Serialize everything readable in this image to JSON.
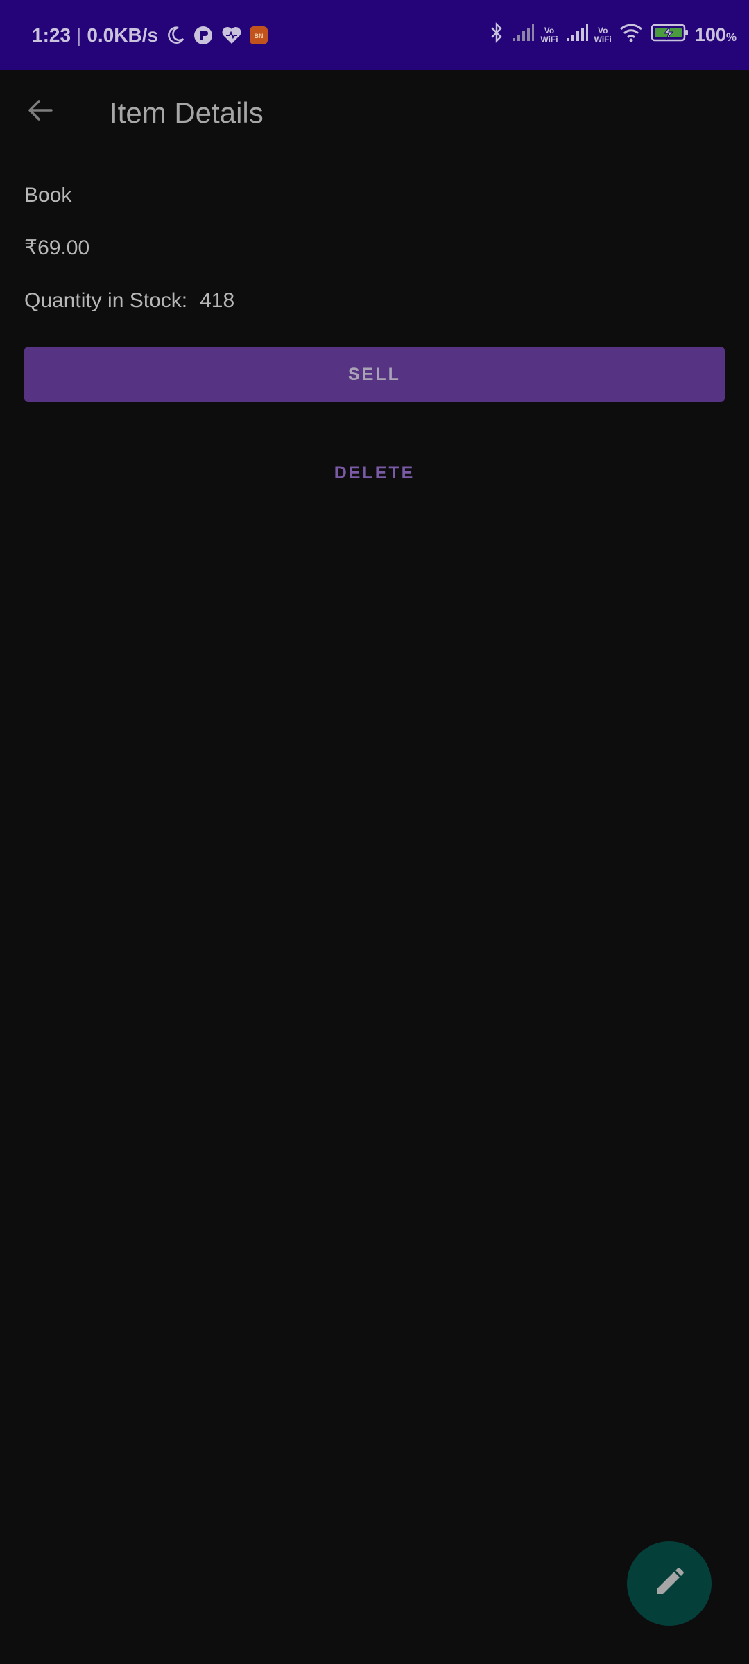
{
  "status_bar": {
    "time": "1:23",
    "separator": "|",
    "network_speed": "0.0KB/s",
    "vowifi_1_top": "Vo",
    "vowifi_1_bottom": "WiFi",
    "vowifi_2_top": "Vo",
    "vowifi_2_bottom": "WiFi",
    "battery_value": "100",
    "battery_unit": "%",
    "icons": [
      "moon-icon",
      "app-notification-icon",
      "heart-icon",
      "app-badge-icon",
      "bluetooth-icon",
      "signal-icon",
      "signal-icon",
      "wifi-icon",
      "battery-charging-icon"
    ]
  },
  "app_bar": {
    "title": "Item Details",
    "back_icon": "arrow-back-icon"
  },
  "item": {
    "name": "Book",
    "price": "₹69.00",
    "stock_label": "Quantity in Stock:",
    "stock_value": "418"
  },
  "actions": {
    "sell_label": "SELL",
    "delete_label": "DELETE",
    "edit_icon": "pencil-icon"
  },
  "colors": {
    "status_bar_bg": "#25047a",
    "background": "#0d0d0d",
    "sell_button_bg": "#573483",
    "delete_text": "#7a5aa6",
    "fab_bg": "#053f3a"
  }
}
